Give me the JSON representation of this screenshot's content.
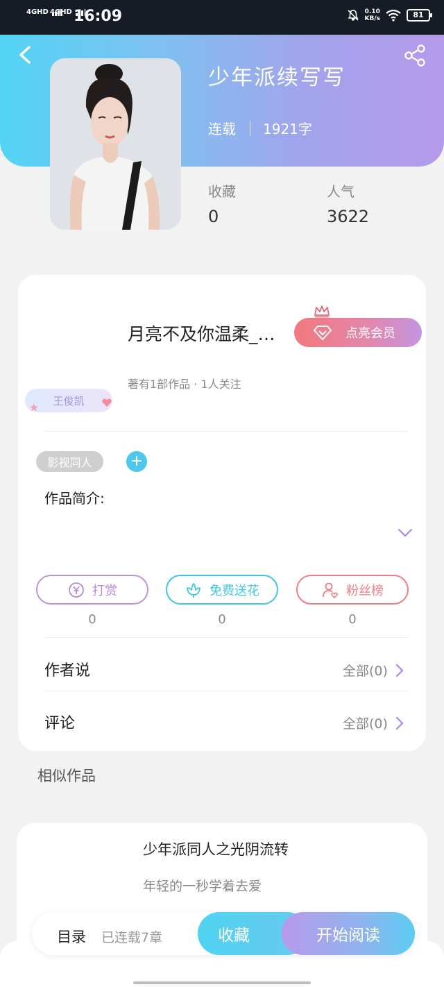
{
  "status_bar": {
    "network_1": "4GHD",
    "network_2": "4GHD",
    "time": "16:09",
    "speed_value": "0.10",
    "speed_unit": "KB/s",
    "battery": "81"
  },
  "book": {
    "title": "少年派续写写",
    "status": "连载",
    "word_count": "1921字",
    "favorites_label": "收藏",
    "favorites_value": "0",
    "popularity_label": "人气",
    "popularity_value": "3622"
  },
  "author": {
    "name": "月亮不及你温柔_…",
    "vip_button": "点亮会员",
    "meta": "著有1部作品 · 1人关注",
    "fan_badge": "王俊凯"
  },
  "details": {
    "tag": "影视同人",
    "add_tag": "+",
    "intro_label": "作品简介:"
  },
  "actions": [
    {
      "label": "打赏",
      "count": "0",
      "icon": "yen-coin-icon",
      "color": "#b98ad8"
    },
    {
      "label": "免费送花",
      "count": "0",
      "icon": "flower-icon",
      "color": "#3fc6e3"
    },
    {
      "label": "粉丝榜",
      "count": "0",
      "icon": "fan-ranking-icon",
      "color": "#ef7f86"
    }
  ],
  "rows": {
    "author_says": "作者说",
    "author_says_all": "全部(0)",
    "comments": "评论",
    "comments_all": "全部(0)"
  },
  "similar": {
    "section_label": "相似作品",
    "title": "少年派同人之光阴流转",
    "description": "年轻的一秒学着去爱"
  },
  "bottom_bar": {
    "toc": "目录",
    "chapters": "已连载7章",
    "collect": "收藏",
    "start_reading": "开始阅读"
  },
  "colors": {
    "header_gradient": [
      "#52d4f4",
      "#b49aea"
    ],
    "accent_cyan": "#4fc7ec",
    "accent_purple": "#b79ae9"
  }
}
